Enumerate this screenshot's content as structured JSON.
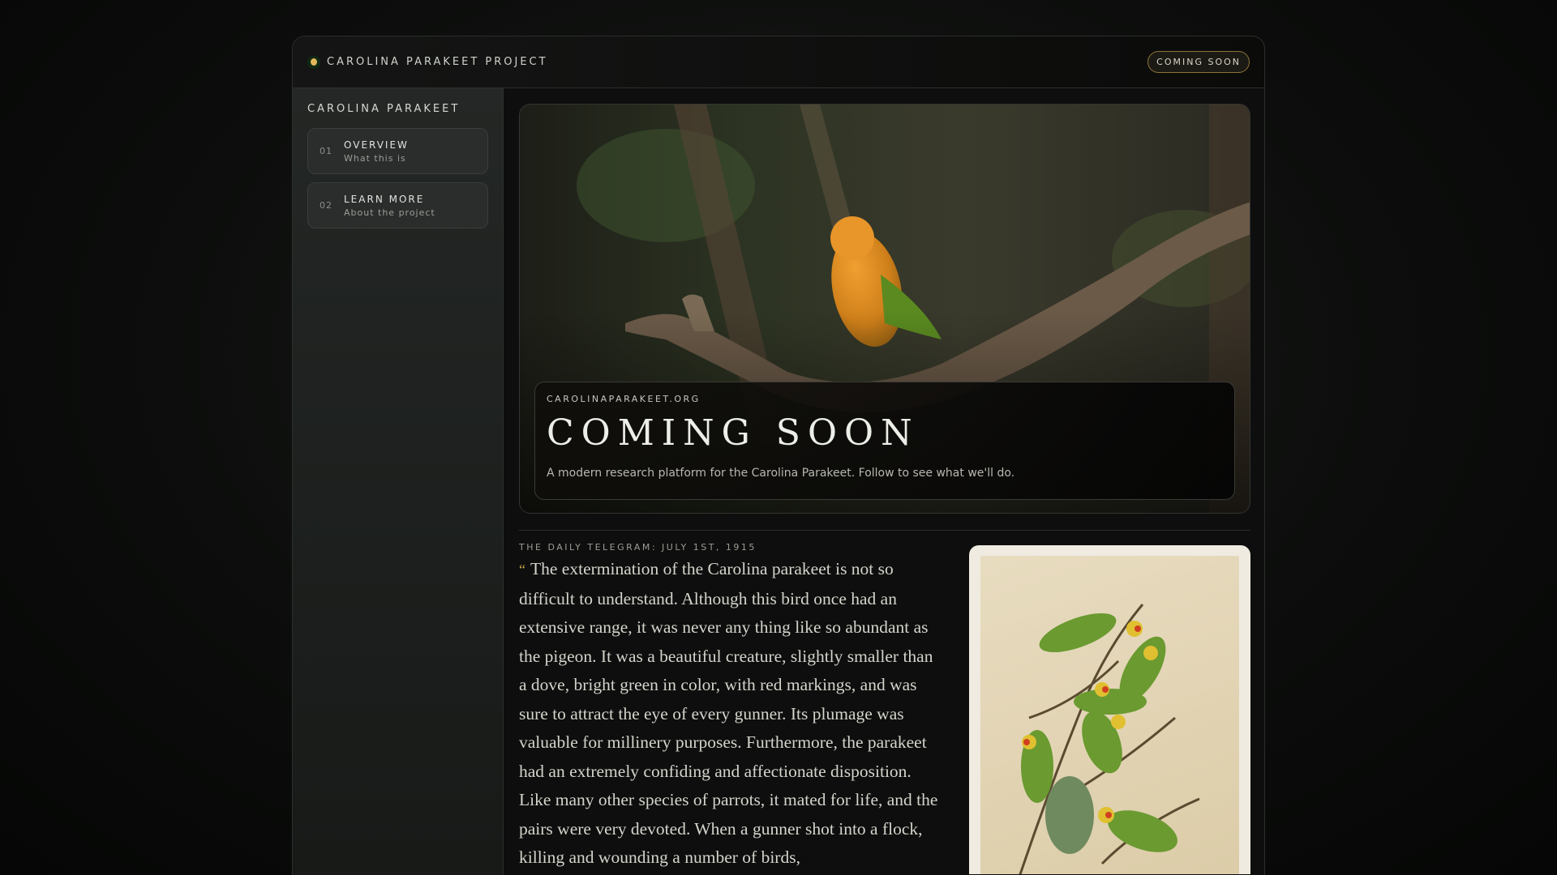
{
  "header": {
    "brand": "CAROLINA PARAKEET PROJECT",
    "badge": "COMING SOON"
  },
  "sidebar": {
    "title": "CAROLINA PARAKEET",
    "items": [
      {
        "num": "01",
        "label": "OVERVIEW",
        "sub": "What this is"
      },
      {
        "num": "02",
        "label": "LEARN MORE",
        "sub": "About the project"
      }
    ]
  },
  "hero": {
    "domain": "CAROLINAPARAKEET.ORG",
    "title": "COMING SOON",
    "subtitle": "A modern research platform for the Carolina Parakeet. Follow to see what we'll do."
  },
  "quote": {
    "source": "THE DAILY TELEGRAM: JULY 1ST, 1915",
    "mark": "“",
    "text": "The extermination of the Carolina parakeet is not so difficult to understand. Although this bird once had an extensive range, it was never any thing like so abundant as the pigeon. It was a beautiful creature, slightly smaller than a dove, bright green in color, with red markings, and was sure to attract the eye of every gunner. Its plumage was valuable for millinery purposes. Furthermore, the parakeet had an extremely confiding and affectionate disposition. Like many other species of parrots, it mated for life, and the pairs were very devoted. When a gunner shot into a flock, killing and wounding a number of birds,"
  },
  "colors": {
    "accent": "#c9a24a",
    "badge_border": "#8d7536",
    "brand_dot": "#e3b85a"
  }
}
